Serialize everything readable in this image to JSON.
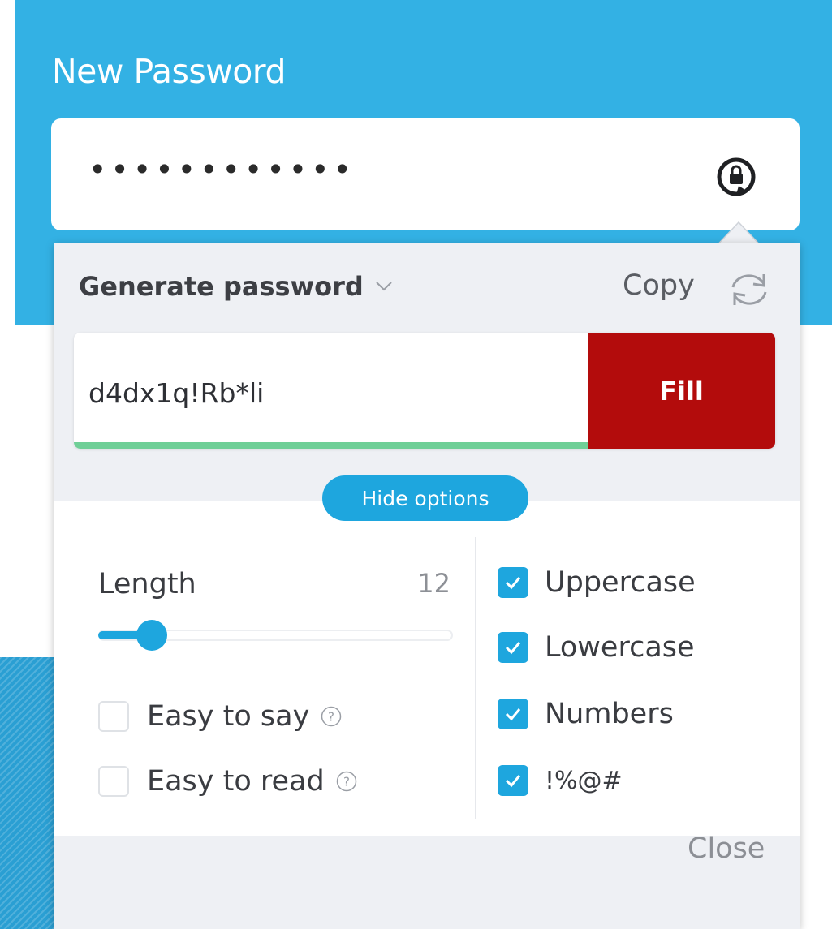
{
  "header": {
    "title": "New Password",
    "password_masked": "••••••••••••",
    "generate_icon": "password-generator-icon"
  },
  "generator": {
    "title": "Generate password",
    "copy_label": "Copy",
    "refresh_icon": "refresh-icon",
    "generated_password": "d4dx1q!Rb*li",
    "fill_label": "Fill",
    "hide_options_label": "Hide options"
  },
  "options": {
    "length_label": "Length",
    "length_value": "12",
    "length_slider_fraction": 0.15,
    "easy_to_say": {
      "label": "Easy to say",
      "checked": false
    },
    "easy_to_read": {
      "label": "Easy to read",
      "checked": false
    },
    "uppercase": {
      "label": "Uppercase",
      "checked": true
    },
    "lowercase": {
      "label": "Lowercase",
      "checked": true
    },
    "numbers": {
      "label": "Numbers",
      "checked": true
    },
    "symbols": {
      "label": "!%@#",
      "checked": true
    }
  },
  "footer": {
    "close_label": "Close"
  },
  "colors": {
    "header_blue": "#33b1e4",
    "accent_blue": "#1ea6de",
    "fill_red": "#b30c0c",
    "strength_green": "#6fcf97"
  }
}
